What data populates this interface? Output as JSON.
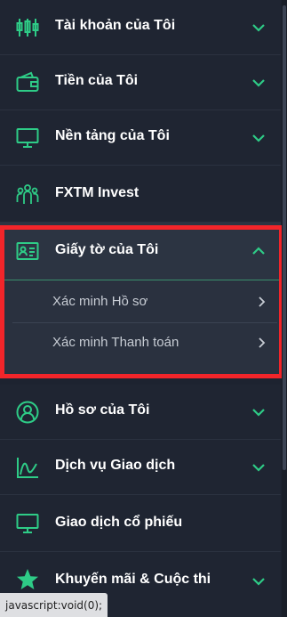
{
  "colors": {
    "accent": "#2ecc87",
    "highlight_border": "#f2252a",
    "background": "#1f2532"
  },
  "menu": {
    "items": [
      {
        "label": "Tài khoản của Tôi",
        "icon": "candlestick-chart-icon",
        "expandable": true
      },
      {
        "label": "Tiền của Tôi",
        "icon": "wallet-icon",
        "expandable": true
      },
      {
        "label": "Nền tảng của Tôi",
        "icon": "monitor-icon",
        "expandable": true
      },
      {
        "label": "FXTM Invest",
        "icon": "people-group-icon",
        "expandable": false
      }
    ],
    "active": {
      "label": "Giấy tờ của Tôi",
      "icon": "id-card-icon",
      "subitems": [
        {
          "label": "Xác minh Hồ sơ"
        },
        {
          "label": "Xác minh Thanh toán"
        }
      ]
    },
    "items_after": [
      {
        "label": "Hồ sơ của Tôi",
        "icon": "user-profile-icon",
        "expandable": true
      },
      {
        "label": "Dịch vụ Giao dịch",
        "icon": "trend-chart-icon",
        "expandable": true
      },
      {
        "label": "Giao dịch cổ phiếu",
        "icon": "monitor-icon",
        "expandable": false
      },
      {
        "label": "Khuyến mãi & Cuộc thi",
        "icon": "star-icon",
        "expandable": true
      }
    ]
  },
  "status_bar": {
    "text": "javascript:void(0);"
  }
}
